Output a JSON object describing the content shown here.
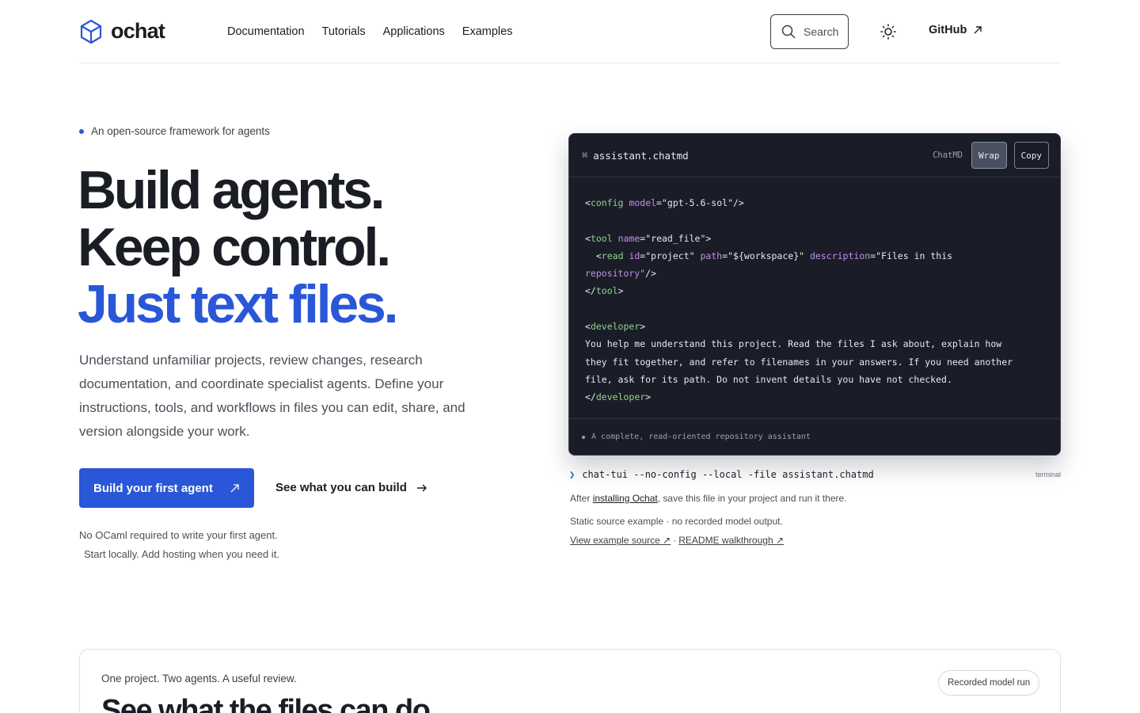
{
  "header": {
    "logo_text": "ochat",
    "nav": [
      "Documentation",
      "Tutorials",
      "Applications",
      "Examples"
    ],
    "search_label": "Search",
    "github_label": "GitHub"
  },
  "hero": {
    "eyebrow": "An open-source framework for agents",
    "title_line1": "Build agents.",
    "title_line2": "Keep control.",
    "title_line3": "Just text files.",
    "lead": "Understand unfamiliar projects, review changes, research documentation, and coordinate specialist agents. Define your instructions, tools, and workflows in files you can edit, share, and version alongside your work.",
    "primary_button": "Build your first agent",
    "secondary_link": "See what you can build",
    "note_line1": "No OCaml required to write your first agent.",
    "note_line2": "Start locally. Add hosting when you need it."
  },
  "code_panel": {
    "filename": "assistant.chatmd",
    "language": "ChatMD",
    "wrap_label": "Wrap",
    "copy_label": "Copy",
    "footer": "A complete, read-oriented repository assistant",
    "config_model": "\"gpt-5.6-sol\"",
    "tool_name": "\"read_file\"",
    "read_id": "\"project\"",
    "read_path": "\"${workspace}\"",
    "read_desc_1": "\"Files in this",
    "read_desc_2": "repository\"",
    "developer_line1": "You help me understand this project. Read the files I ask about, explain how",
    "developer_line2": "they fit together, and refer to filenames in your answers. If you need another",
    "developer_line3": "file, ask for its path. Do not invent details you have not checked."
  },
  "terminal": {
    "command": "chat-tui --no-config --local -file assistant.chatmd",
    "label": "terminal"
  },
  "after_note": {
    "before": "After ",
    "link": "installing Ochat",
    "after": ", save this file in your project and run it there."
  },
  "static_note": "Static source example · no recorded model output.",
  "source_links": {
    "source": "View example source ↗",
    "separator": "·",
    "readme": "README walkthrough ↗"
  },
  "card": {
    "eyebrow": "One project. Two agents. A useful review.",
    "title": "See what the files can do",
    "badge": "Recorded model run"
  },
  "colors": {
    "accent": "#2957d8",
    "code_bg": "#1a1d27",
    "code_tag": "#8fd48a",
    "code_attr": "#c58fe8"
  }
}
